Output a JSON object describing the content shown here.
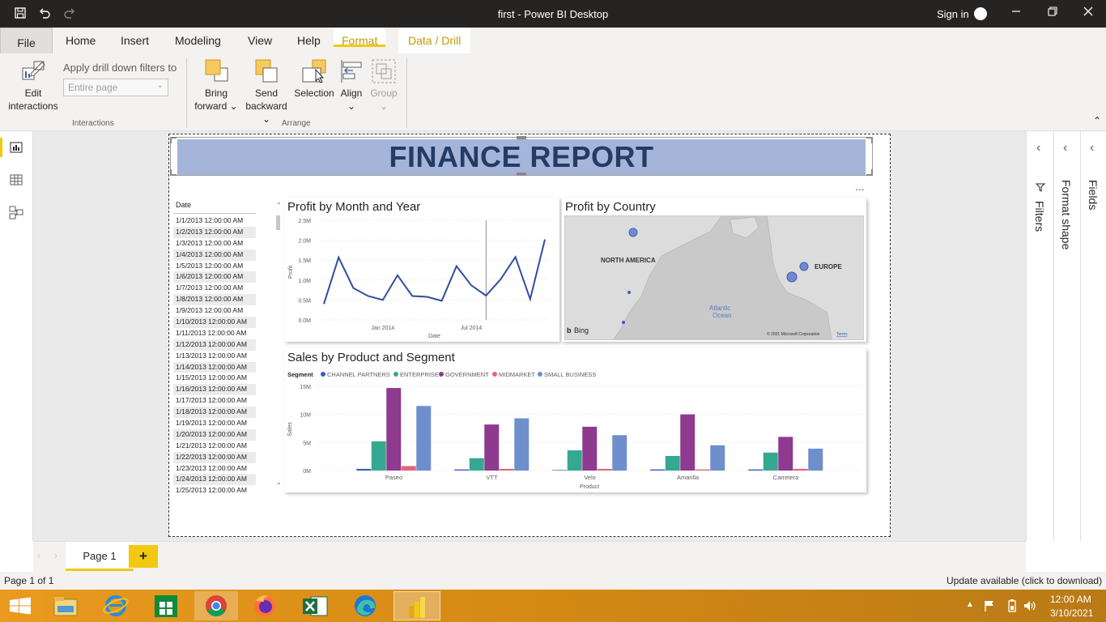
{
  "app": {
    "window_title": "first - Power BI Desktop",
    "sign_in": "Sign in"
  },
  "ribbon_tabs": {
    "file": "File",
    "home": "Home",
    "insert": "Insert",
    "modeling": "Modeling",
    "view": "View",
    "help": "Help",
    "format": "Format",
    "data_drill": "Data / Drill"
  },
  "ribbon": {
    "edit_interactions": [
      "Edit",
      "interactions"
    ],
    "apply_drill_label": "Apply drill down filters to",
    "apply_drill_placeholder": "Entire page",
    "interactions_group": "Interactions",
    "bring_forward": [
      "Bring",
      "forward"
    ],
    "send_backward": [
      "Send",
      "backward"
    ],
    "selection": "Selection",
    "align": "Align",
    "group": "Group",
    "arrange_group": "Arrange"
  },
  "report": {
    "banner_title": "FINANCE REPORT",
    "more_options": "..."
  },
  "slicer": {
    "header": "Date",
    "items": [
      "1/1/2013 12:00:00 AM",
      "1/2/2013 12:00:00 AM",
      "1/3/2013 12:00:00 AM",
      "1/4/2013 12:00:00 AM",
      "1/5/2013 12:00:00 AM",
      "1/6/2013 12:00:00 AM",
      "1/7/2013 12:00:00 AM",
      "1/8/2013 12:00:00 AM",
      "1/9/2013 12:00:00 AM",
      "1/10/2013 12:00:00 AM",
      "1/11/2013 12:00:00 AM",
      "1/12/2013 12:00:00 AM",
      "1/13/2013 12:00:00 AM",
      "1/14/2013 12:00:00 AM",
      "1/15/2013 12:00:00 AM",
      "1/16/2013 12:00:00 AM",
      "1/17/2013 12:00:00 AM",
      "1/18/2013 12:00:00 AM",
      "1/19/2013 12:00:00 AM",
      "1/20/2013 12:00:00 AM",
      "1/21/2013 12:00:00 AM",
      "1/22/2013 12:00:00 AM",
      "1/23/2013 12:00:00 AM",
      "1/24/2013 12:00:00 AM",
      "1/25/2013 12:00:00 AM"
    ]
  },
  "map": {
    "title": "Profit by Country",
    "label_north_america": "NORTH AMERICA",
    "label_europe": "EUROPE",
    "label_atlantic": [
      "Atlantic",
      "Ocean"
    ],
    "bing": "Bing",
    "copyright": "© 2021 Microsoft Corporation",
    "terms": "Terms"
  },
  "panes": {
    "filters": "Filters",
    "format_shape": "Format shape",
    "fields": "Fields"
  },
  "page_tabs": {
    "page1": "Page 1",
    "add": "+"
  },
  "status": {
    "page_count": "Page 1 of 1",
    "update": "Update available (click to download)"
  },
  "taskbar": {
    "time": "12:00 AM",
    "date": "3/10/2021"
  },
  "colors": {
    "channel_partners": "#3b5eb5",
    "enterprise": "#35a891",
    "government": "#8e3a8f",
    "midmarket": "#e0657b",
    "small_business": "#6f8fcc",
    "line": "#2f4f9a",
    "banner": "#a5b4d9",
    "format_accent": "#f2c811"
  },
  "chart_data": [
    {
      "type": "line",
      "title": "Profit by Month and Year",
      "xlabel": "Date",
      "ylabel": "Profit",
      "x_ticks": [
        "Jan 2014",
        "Jul 2014"
      ],
      "y_ticks": [
        "0.0M",
        "0.5M",
        "1.0M",
        "1.5M",
        "2.0M",
        "2.5M"
      ],
      "ylim": [
        0,
        2500000
      ],
      "x": [
        "Sep 2013",
        "Oct 2013",
        "Nov 2013",
        "Dec 2013",
        "Jan 2014",
        "Feb 2014",
        "Mar 2014",
        "Apr 2014",
        "May 2014",
        "Jun 2014",
        "Jul 2014",
        "Aug 2014",
        "Sep 2014",
        "Oct 2014",
        "Nov 2014",
        "Dec 2014"
      ],
      "values": [
        400000,
        1570000,
        800000,
        600000,
        500000,
        1120000,
        600000,
        580000,
        480000,
        1350000,
        870000,
        610000,
        1020000,
        1580000,
        520000,
        2020000
      ]
    },
    {
      "type": "bar",
      "title": "Sales by Product and Segment",
      "xlabel": "Product",
      "ylabel": "Sales",
      "legend_title": "Segment",
      "categories": [
        "Paseo",
        "VTT",
        "Velo",
        "Amarilla",
        "Carretera"
      ],
      "y_ticks": [
        "0M",
        "5M",
        "10M",
        "15M"
      ],
      "ylim": [
        0,
        15000000
      ],
      "series": [
        {
          "name": "CHANNEL PARTNERS",
          "values": [
            300000,
            200000,
            100000,
            200000,
            200000
          ]
        },
        {
          "name": "ENTERPRISE",
          "values": [
            5200000,
            2200000,
            3600000,
            2600000,
            3200000
          ]
        },
        {
          "name": "GOVERNMENT",
          "values": [
            14700000,
            8200000,
            7800000,
            10000000,
            6000000
          ]
        },
        {
          "name": "MIDMARKET",
          "values": [
            800000,
            300000,
            300000,
            200000,
            300000
          ]
        },
        {
          "name": "SMALL BUSINESS",
          "values": [
            11500000,
            9300000,
            6300000,
            4500000,
            3900000
          ]
        }
      ]
    }
  ]
}
